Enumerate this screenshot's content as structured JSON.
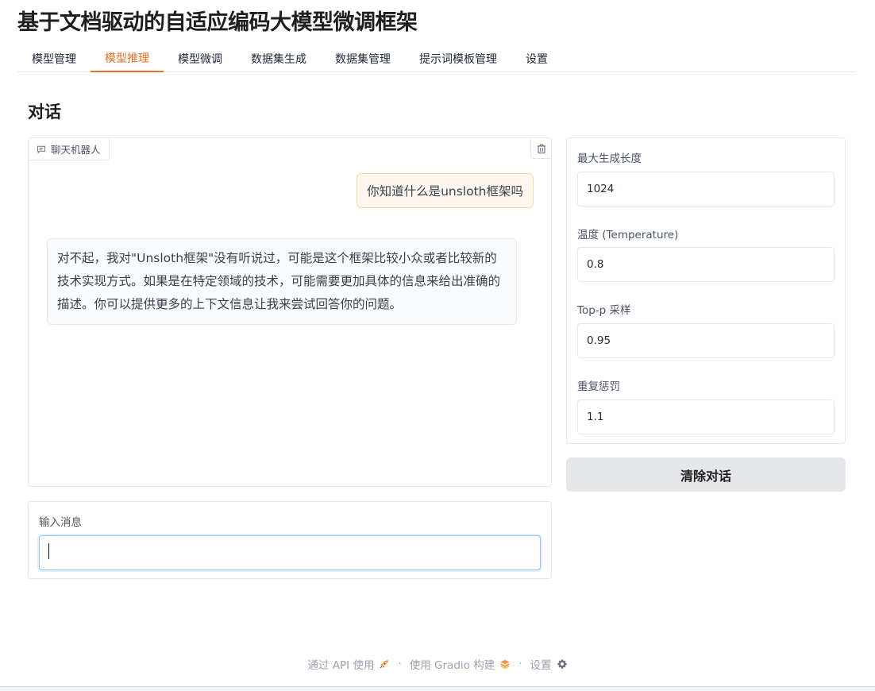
{
  "app": {
    "title": "基于文档驱动的自适应编码大模型微调框架"
  },
  "tabs": [
    {
      "label": "模型管理",
      "active": false
    },
    {
      "label": "模型推理",
      "active": true
    },
    {
      "label": "模型微调",
      "active": false
    },
    {
      "label": "数据集生成",
      "active": false
    },
    {
      "label": "数据集管理",
      "active": false
    },
    {
      "label": "提示词模板管理",
      "active": false
    },
    {
      "label": "设置",
      "active": false
    }
  ],
  "section": {
    "title": "对话"
  },
  "chatbot": {
    "label": "聊天机器人",
    "messages": [
      {
        "role": "user",
        "text": "你知道什么是unsloth框架吗"
      },
      {
        "role": "bot",
        "text": "对不起，我对\"Unsloth框架\"没有听说过，可能是这个框架比较小众或者比较新的技术实现方式。如果是在特定领域的技术，可能需要更加具体的信息来给出准确的描述。你可以提供更多的上下文信息让我来尝试回答你的问题。"
      }
    ]
  },
  "input": {
    "label": "输入消息",
    "value": ""
  },
  "settings": {
    "max_length": {
      "label": "最大生成长度",
      "value": "1024"
    },
    "temperature": {
      "label": "温度 (Temperature)",
      "value": "0.8"
    },
    "top_p": {
      "label": "Top-p 采样",
      "value": "0.95"
    },
    "repetition_penalty": {
      "label": "重复惩罚",
      "value": "1.1"
    }
  },
  "clear_button": {
    "label": "清除对话"
  },
  "footer": {
    "api_label": "通过 API 使用",
    "gradio_label": "使用 Gradio 构建",
    "settings_label": "设置",
    "separator": "·"
  },
  "colors": {
    "accent": "#ea6e1d",
    "user_bubble": "#fff7ed",
    "bot_bubble": "#f9fafb",
    "button_bg": "#e5e7eb"
  },
  "icons": {
    "chat_label": "chat-bubble-icon",
    "trash": "trash-icon",
    "api": "rocket-icon",
    "gradio": "gradio-logo-icon",
    "settings": "gear-icon"
  }
}
